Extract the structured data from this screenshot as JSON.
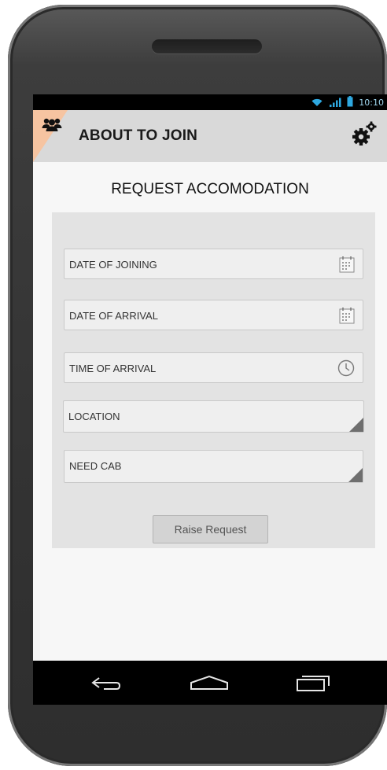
{
  "status_bar": {
    "time": "10:10",
    "icons": [
      "wifi-icon",
      "signal-icon",
      "battery-icon"
    ]
  },
  "app_bar": {
    "title": "ABOUT TO JOIN",
    "left_icon": "users-icon",
    "right_icon": "settings-gears-icon"
  },
  "page": {
    "title": "REQUEST ACCOMODATION"
  },
  "form": {
    "fields": [
      {
        "label": "DATE OF JOINING",
        "icon": "calendar-icon"
      },
      {
        "label": "DATE OF ARRIVAL",
        "icon": "calendar-icon"
      },
      {
        "label": "TIME OF ARRIVAL",
        "icon": "clock-icon"
      },
      {
        "label": "LOCATION",
        "icon": "dropdown-corner"
      },
      {
        "label": "NEED CAB",
        "icon": "dropdown-corner"
      }
    ],
    "submit_label": "Raise Request"
  },
  "nav_bar": {
    "buttons": [
      "back-icon",
      "home-icon",
      "recent-apps-icon"
    ]
  },
  "colors": {
    "accent_corner": "#f6c4a1",
    "status_time": "#9fd6ee",
    "wifi": "#2ea8e0"
  }
}
